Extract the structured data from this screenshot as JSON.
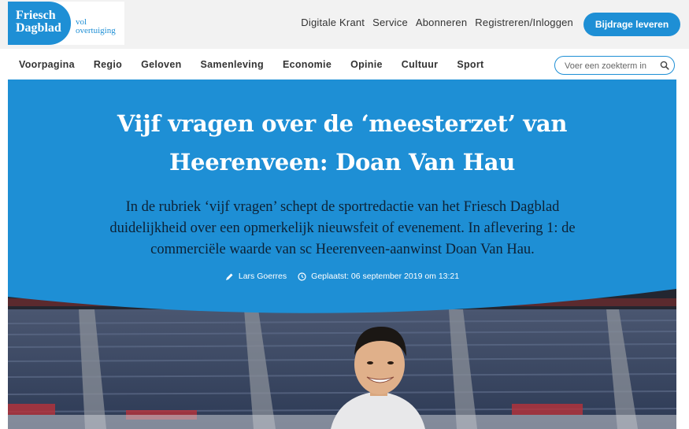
{
  "brand": {
    "name_line1": "Friesch",
    "name_line2": "Dagblad",
    "tagline_line1": "vol",
    "tagline_line2": "overtuiging",
    "accent_color": "#1e8fd5"
  },
  "top_links": [
    "Digitale Krant",
    "Service",
    "Abonneren",
    "Registreren/Inloggen"
  ],
  "donate_label": "Bijdrage leveren",
  "nav": {
    "items": [
      "Voorpagina",
      "Regio",
      "Geloven",
      "Samenleving",
      "Economie",
      "Opinie",
      "Cultuur",
      "Sport"
    ],
    "search_placeholder": "Voer een zoekterm in"
  },
  "article": {
    "title_line1": "Vijf vragen over de ‘meesterzet’ van",
    "title_line2": "Heerenveen: Doan Van Hau",
    "lead_line1": "In de rubriek ‘vijf vragen’ schept de sportredactie van het Friesch Dagblad",
    "lead_line2": "duidelijkheid over een opmerkelijk nieuwsfeit of evenement. In aflevering 1: de",
    "lead_line3": "commerciële waarde van sc Heerenveen-aanwinst Doan Van Hau.",
    "author": "Lars Goerres",
    "published": "Geplaatst: 06 september 2019 om 13:21",
    "author_icon": "pen-icon",
    "time_icon": "clock-icon"
  }
}
